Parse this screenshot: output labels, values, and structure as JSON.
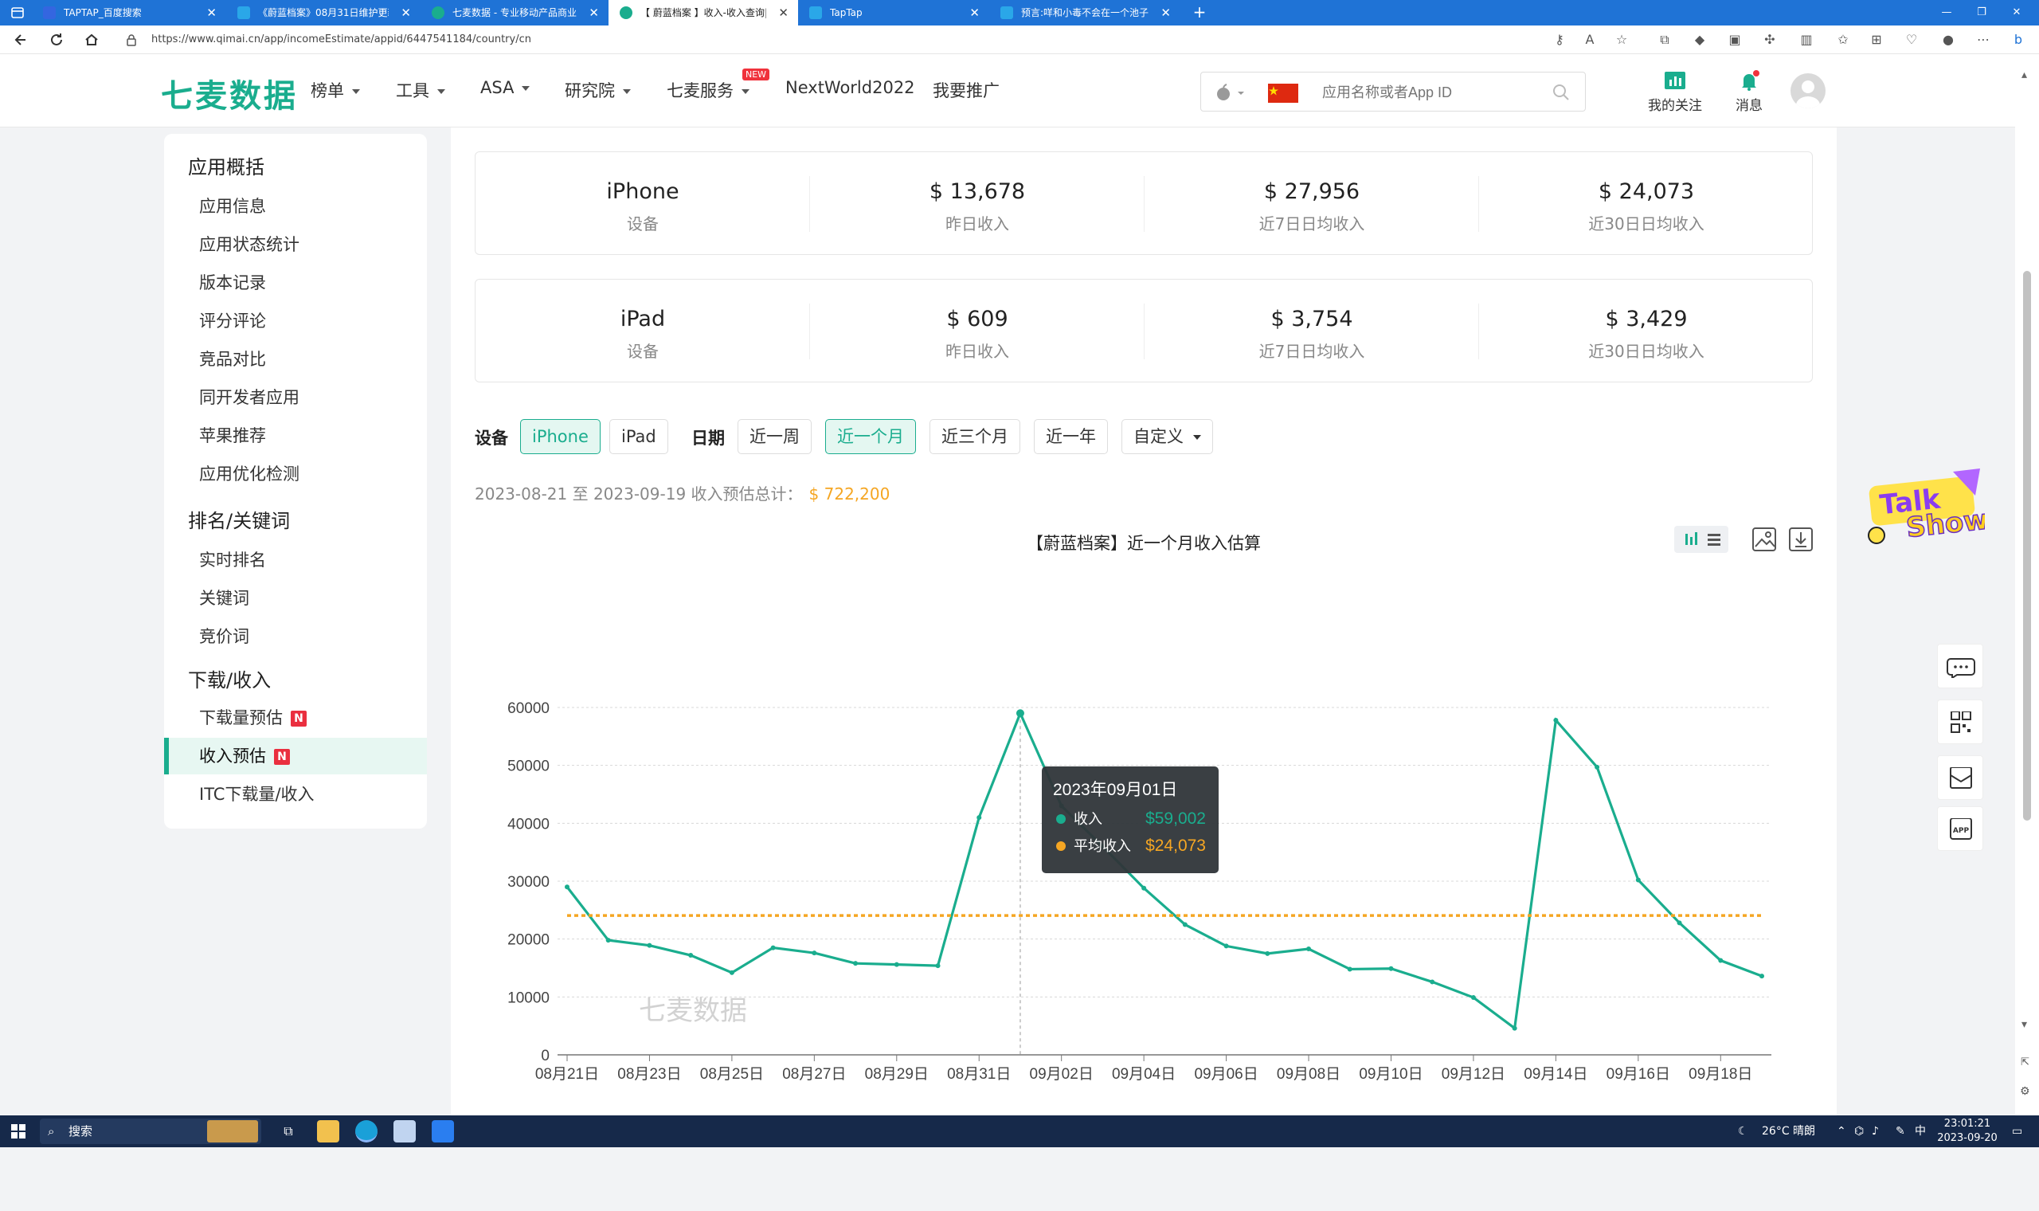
{
  "browser": {
    "tabs": [
      {
        "title": "TAPTAP_百度搜索",
        "active": false
      },
      {
        "title": "《蔚蓝档案》08月31日维护更新",
        "active": false
      },
      {
        "title": "七麦数据 - 专业移动产品商业分析",
        "active": false
      },
      {
        "title": "【 蔚蓝档案 】收入-收入查询|收",
        "active": true
      },
      {
        "title": "TapTap",
        "active": false
      },
      {
        "title": "预言:咩和小毒不会在一个池子",
        "active": false
      }
    ],
    "new_tab": "+",
    "url": "https://www.qimai.cn/app/incomeEstimate/appid/6447541184/country/cn"
  },
  "header": {
    "logo": "七麦数据",
    "nav": [
      "榜单",
      "工具",
      "ASA",
      "研究院",
      "七麦服务",
      "NextWorld2022",
      "我要推广"
    ],
    "new_badge": "NEW",
    "search_placeholder": "应用名称或者App ID",
    "follow": "我的关注",
    "messages": "消息"
  },
  "sidebar": {
    "groups": [
      {
        "title": "应用概括",
        "items": [
          "应用信息",
          "应用状态统计",
          "版本记录",
          "评分评论",
          "竞品对比",
          "同开发者应用",
          "苹果推荐",
          "应用优化检测"
        ]
      },
      {
        "title": "排名/关键词",
        "items": [
          "实时排名",
          "关键词",
          "竞价词"
        ]
      },
      {
        "title": "下载/收入",
        "items": [
          "下载量预估",
          "收入预估",
          "ITC下载量/收入"
        ]
      }
    ],
    "n_badge": "N",
    "active_item": "收入预估"
  },
  "cards": [
    {
      "device": "iPhone",
      "device_label": "设备",
      "yesterday": "$ 13,678",
      "yesterday_label": "昨日收入",
      "avg7": "$ 27,956",
      "avg7_label": "近7日日均收入",
      "avg30": "$ 24,073",
      "avg30_label": "近30日日均收入"
    },
    {
      "device": "iPad",
      "device_label": "设备",
      "yesterday": "$ 609",
      "yesterday_label": "昨日收入",
      "avg7": "$ 3,754",
      "avg7_label": "近7日日均收入",
      "avg30": "$ 3,429",
      "avg30_label": "近30日日均收入"
    }
  ],
  "filters": {
    "device_label": "设备",
    "devices": [
      "iPhone",
      "iPad"
    ],
    "date_label": "日期",
    "dates": [
      "近一周",
      "近一个月",
      "近三个月",
      "近一年",
      "自定义"
    ],
    "active_device": "iPhone",
    "active_date": "近一个月"
  },
  "summary": {
    "text": "2023-08-21 至 2023-09-19 收入预估总计：",
    "amount": "$ 722,200"
  },
  "watermark": "七麦数据",
  "tooltip": {
    "date": "2023年09月01日",
    "row1_label": "收入",
    "row1_value": "$59,002",
    "row2_label": "平均收入",
    "row2_value": "$24,073"
  },
  "colors": {
    "brand": "#1aad8e",
    "average": "#f5a623",
    "tab_bar": "#1f73d6"
  },
  "chart_data": {
    "type": "line",
    "title": "【蔚蓝档案】近一个月收入估算",
    "x": [
      "08月21日",
      "08月22日",
      "08月23日",
      "08月24日",
      "08月25日",
      "08月26日",
      "08月27日",
      "08月28日",
      "08月29日",
      "08月30日",
      "08月31日",
      "09月01日",
      "09月02日",
      "09月03日",
      "09月04日",
      "09月05日",
      "09月06日",
      "09月07日",
      "09月08日",
      "09月09日",
      "09月10日",
      "09月11日",
      "09月12日",
      "09月13日",
      "09月14日",
      "09月15日",
      "09月16日",
      "09月17日",
      "09月18日",
      "09月19日"
    ],
    "x_tick_labels": [
      "08月21日",
      "08月23日",
      "08月25日",
      "08月27日",
      "08月29日",
      "08月31日",
      "09月02日",
      "09月04日",
      "09月06日",
      "09月08日",
      "09月10日",
      "09月12日",
      "09月14日",
      "09月16日",
      "09月18日"
    ],
    "series": [
      {
        "name": "收入",
        "color": "#1aad8e",
        "values": [
          29000,
          19800,
          18900,
          17200,
          14200,
          18500,
          17600,
          15800,
          15600,
          15400,
          41000,
          59002,
          43000,
          36000,
          28800,
          22500,
          18800,
          17500,
          18300,
          14800,
          14900,
          12600,
          9900,
          4600,
          57800,
          49700,
          30200,
          22800,
          16300,
          13600
        ]
      },
      {
        "name": "平均收入",
        "color": "#f5a623",
        "values": [
          24073,
          24073,
          24073,
          24073,
          24073,
          24073,
          24073,
          24073,
          24073,
          24073,
          24073,
          24073,
          24073,
          24073,
          24073,
          24073,
          24073,
          24073,
          24073,
          24073,
          24073,
          24073,
          24073,
          24073,
          24073,
          24073,
          24073,
          24073,
          24073,
          24073
        ]
      }
    ],
    "ylim": [
      0,
      60000
    ],
    "y_ticks": [
      0,
      10000,
      20000,
      30000,
      40000,
      50000,
      60000
    ],
    "grid": true,
    "legend": "bottom-center",
    "highlight_index": 11
  },
  "taskbar": {
    "search": "搜索",
    "weather": "26°C 晴朗",
    "ime": "中",
    "time": "23:01:21",
    "date": "2023-09-20"
  }
}
